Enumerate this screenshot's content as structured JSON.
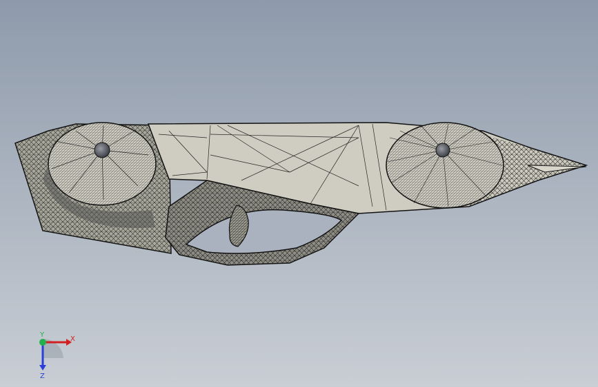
{
  "viewport": {
    "background_top": "#8e9aab",
    "background_bottom": "#c9ced5"
  },
  "model": {
    "display_mode": "shaded-with-edges",
    "face_color": "#c8c7bb",
    "edge_color": "#1a1a1a",
    "hub_color": "#5e6068"
  },
  "triad": {
    "x_label": "X",
    "y_label": "Y",
    "z_label": "Z",
    "x_color": "#d21f1f",
    "y_color": "#22b14c",
    "z_color": "#2a3fd6"
  }
}
